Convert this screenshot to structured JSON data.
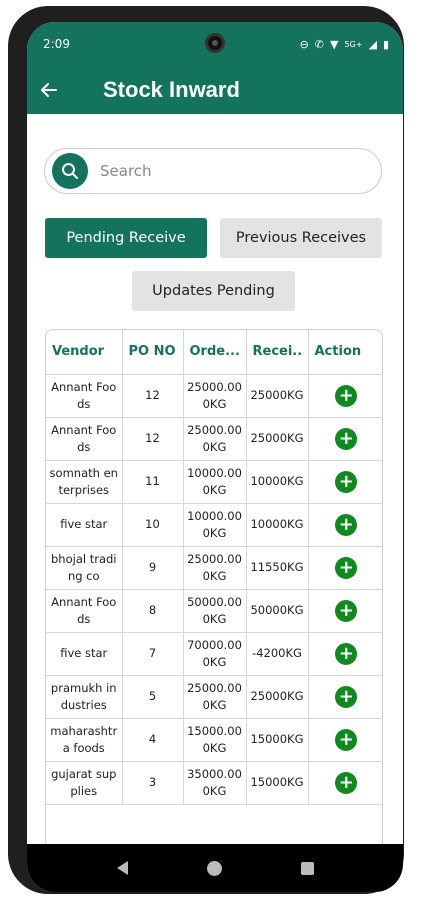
{
  "status_bar": {
    "time": "2:09",
    "network": "5G+"
  },
  "app_bar": {
    "title": "Stock Inward"
  },
  "search": {
    "placeholder": "Search"
  },
  "buttons": {
    "pending_receive": "Pending Receive",
    "previous_receives": "Previous Receives",
    "updates_pending": "Updates Pending"
  },
  "table": {
    "headers": [
      "Vendor",
      "PO NO",
      "Orde...",
      "Recei..",
      "Action"
    ],
    "rows": [
      {
        "vendor": "Annant Foods",
        "po": "12",
        "ordered": "25000.000KG",
        "received": "25000KG"
      },
      {
        "vendor": "Annant Foods",
        "po": "12",
        "ordered": "25000.000KG",
        "received": "25000KG"
      },
      {
        "vendor": "somnath enterprises",
        "po": "11",
        "ordered": "10000.000KG",
        "received": "10000KG"
      },
      {
        "vendor": "five star",
        "po": "10",
        "ordered": "10000.000KG",
        "received": "10000KG"
      },
      {
        "vendor": "bhojal trading co",
        "po": "9",
        "ordered": "25000.000KG",
        "received": "11550KG"
      },
      {
        "vendor": "Annant Foods",
        "po": "8",
        "ordered": "50000.000KG",
        "received": "50000KG"
      },
      {
        "vendor": "five star",
        "po": "7",
        "ordered": "70000.000KG",
        "received": "-4200KG"
      },
      {
        "vendor": "pramukh industries",
        "po": "5",
        "ordered": "25000.000KG",
        "received": "25000KG"
      },
      {
        "vendor": "maharashtra foods",
        "po": "4",
        "ordered": "15000.000KG",
        "received": "15000KG"
      },
      {
        "vendor": "gujarat supplies",
        "po": "3",
        "ordered": "35000.000KG",
        "received": "15000KG"
      }
    ]
  },
  "colors": {
    "primary": "#13735d",
    "action": "#0f8a1e",
    "secondary_button": "#e3e3e3"
  },
  "icons": {
    "back": "arrow-left-icon",
    "search": "search-icon",
    "action": "plus-circle-icon"
  }
}
